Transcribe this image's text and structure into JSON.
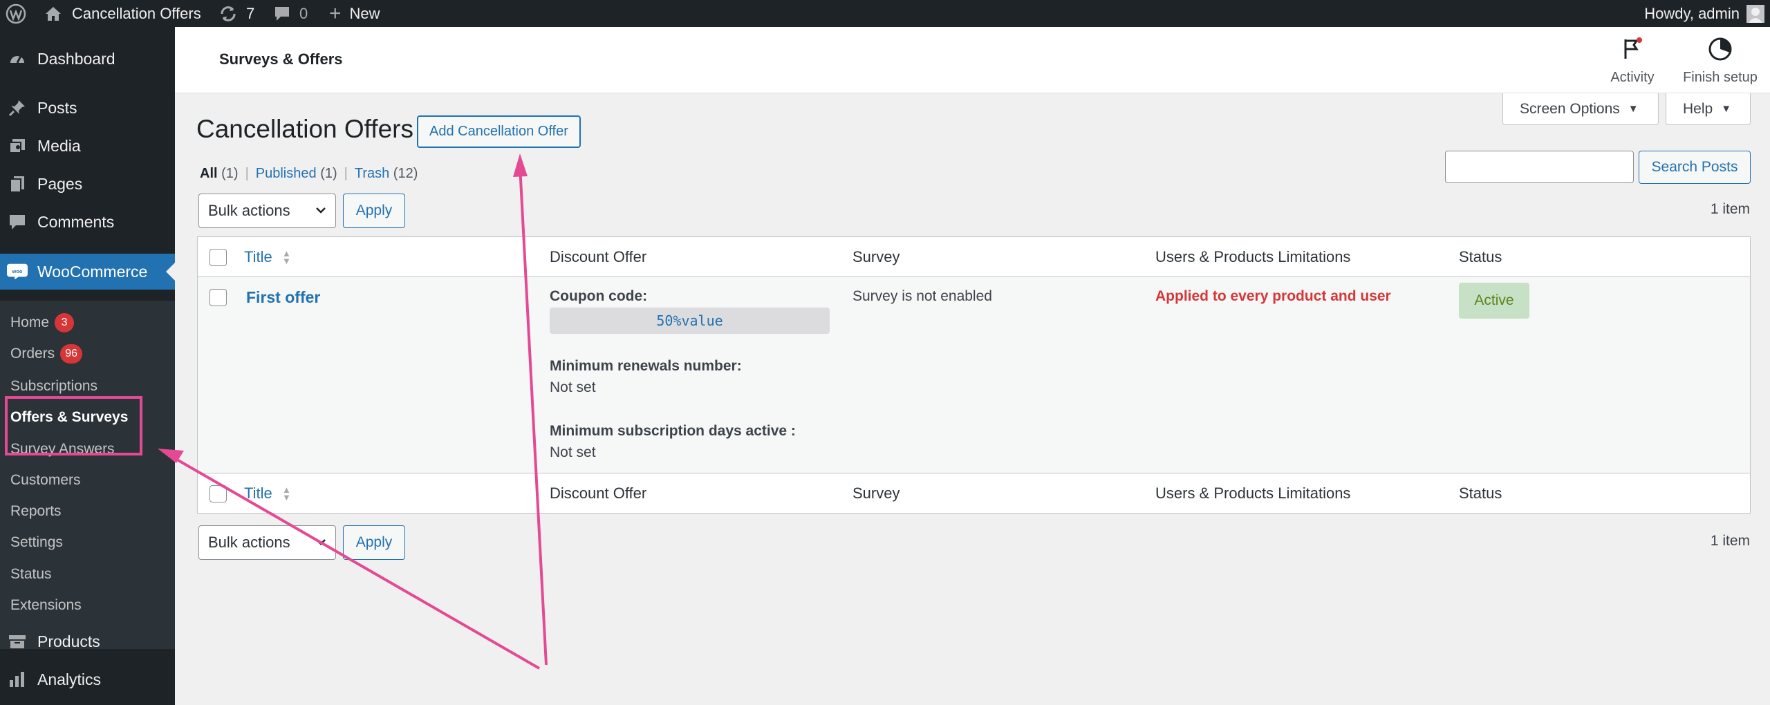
{
  "admin_bar": {
    "site_name": "Cancellation Offers",
    "updates_count": "7",
    "comments_count": "0",
    "new_label": "New",
    "howdy": "Howdy, admin"
  },
  "sidebar": {
    "items": [
      {
        "label": "Dashboard",
        "icon": "dashboard-icon"
      },
      {
        "label": "Posts",
        "icon": "pin-icon"
      },
      {
        "label": "Media",
        "icon": "media-icon"
      },
      {
        "label": "Pages",
        "icon": "pages-icon"
      },
      {
        "label": "Comments",
        "icon": "comment-icon"
      },
      {
        "label": "WooCommerce",
        "icon": "woo-icon"
      },
      {
        "label": "Products",
        "icon": "archive-icon"
      },
      {
        "label": "Analytics",
        "icon": "bar-chart-icon"
      }
    ],
    "submenu": [
      {
        "label": "Home",
        "count": "3"
      },
      {
        "label": "Orders",
        "count": "96"
      },
      {
        "label": "Subscriptions"
      },
      {
        "label": "Offers & Surveys"
      },
      {
        "label": "Survey Answers"
      },
      {
        "label": "Customers"
      },
      {
        "label": "Reports"
      },
      {
        "label": "Settings"
      },
      {
        "label": "Status"
      },
      {
        "label": "Extensions"
      }
    ]
  },
  "header": {
    "title": "Surveys & Offers",
    "activity_label": "Activity",
    "finish_setup_label": "Finish setup"
  },
  "screen_options_label": "Screen Options",
  "help_label": "Help",
  "page": {
    "title": "Cancellation Offers",
    "add_button": "Add Cancellation Offer",
    "filters": {
      "all": "All",
      "all_count": "(1)",
      "published": "Published",
      "published_count": "(1)",
      "trash": "Trash",
      "trash_count": "(12)",
      "sep": "|"
    },
    "search_button": "Search Posts",
    "bulk_actions": "Bulk actions",
    "apply": "Apply",
    "item_count": "1 item"
  },
  "table": {
    "columns": [
      "Title",
      "Discount Offer",
      "Survey",
      "Users & Products Limitations",
      "Status"
    ],
    "rows": [
      {
        "title": "First offer",
        "coupon_label": "Coupon code:",
        "coupon_value": "50%value",
        "min_renewals_label": "Minimum renewals number:",
        "min_renewals_value": "Not set",
        "min_days_label": "Minimum subscription days active :",
        "min_days_value": "Not set",
        "survey": "Survey is not enabled",
        "limitations": "Applied to every product and user",
        "status": "Active"
      }
    ]
  },
  "colors": {
    "admin_dark": "#1d2327",
    "accent_blue": "#2271b1",
    "annotation_pink": "#e44a93",
    "error_red": "#d63638",
    "status_green_bg": "#c6e1c6"
  }
}
